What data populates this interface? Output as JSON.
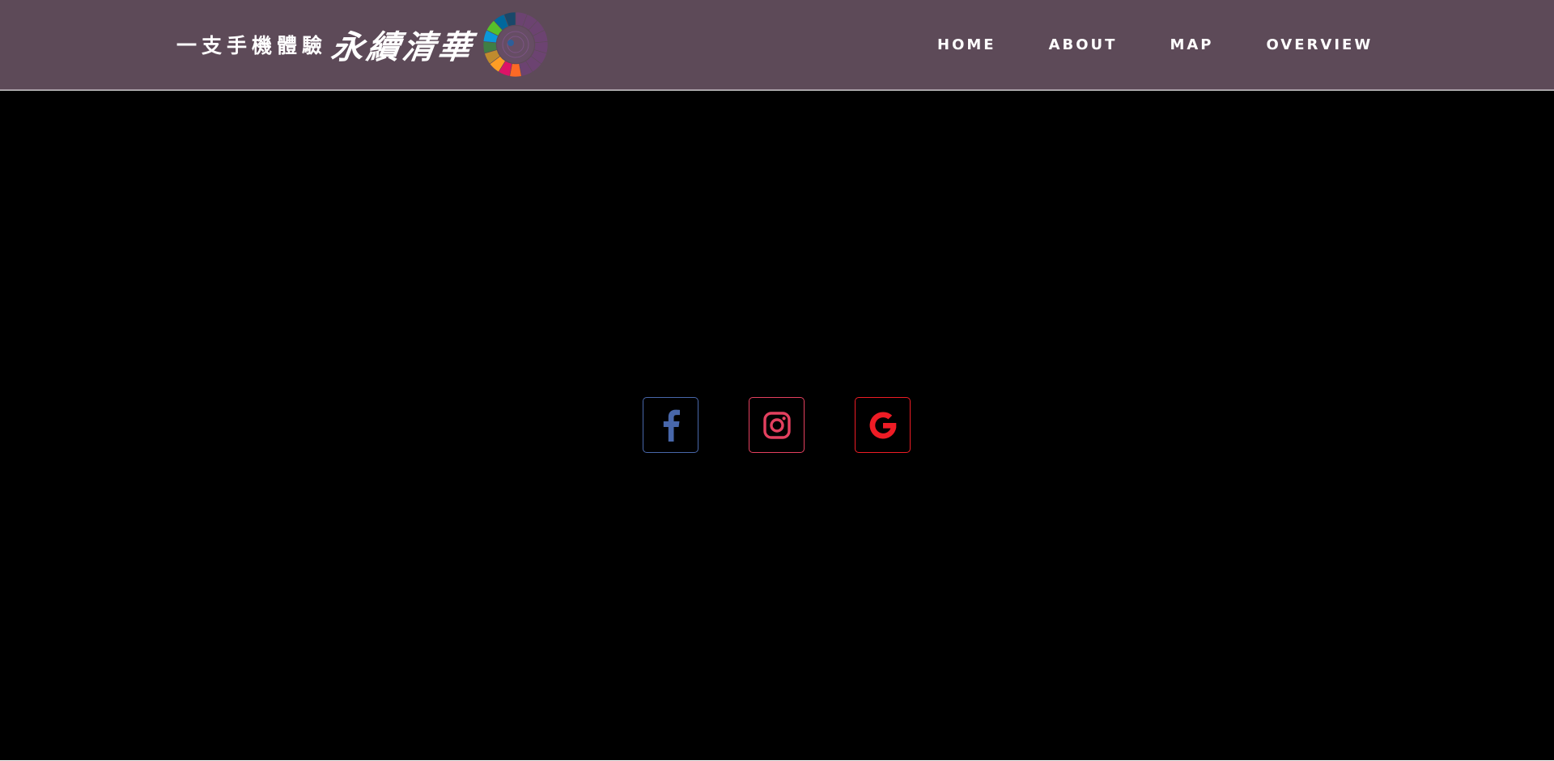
{
  "header": {
    "logo": {
      "small_text": "一支手機體驗",
      "large_text": "永續清華",
      "wheel_icon": "sdg-wheel-icon"
    },
    "nav": [
      {
        "label": "HOME"
      },
      {
        "label": "ABOUT"
      },
      {
        "label": "MAP"
      },
      {
        "label": "OVERVIEW"
      }
    ],
    "background": "#5d4a58"
  },
  "main": {
    "background": "#000000",
    "social": [
      {
        "icon": "facebook-icon",
        "color": "#4867aa"
      },
      {
        "icon": "instagram-icon",
        "color": "#e4405f"
      },
      {
        "icon": "google-icon",
        "color": "#ee1c25"
      }
    ]
  }
}
